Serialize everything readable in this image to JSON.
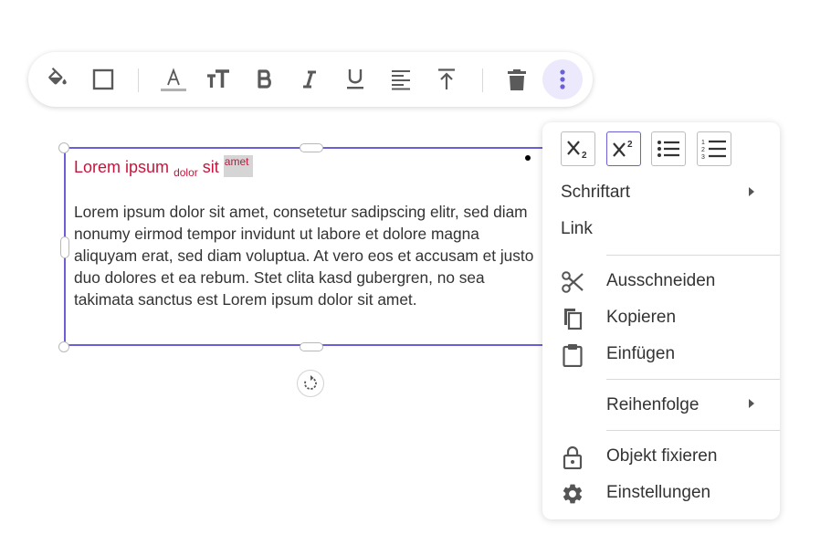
{
  "toolbar": {
    "buttons": [
      {
        "name": "fill-color",
        "icon": "paint-bucket-icon"
      },
      {
        "name": "border",
        "icon": "square-outline-icon"
      },
      {
        "name": "font-color",
        "icon": "font-color-icon",
        "glyph": "A"
      },
      {
        "name": "font-size",
        "icon": "font-size-icon",
        "glyph": "тT"
      },
      {
        "name": "bold",
        "icon": "bold-icon",
        "glyph": "B"
      },
      {
        "name": "italic",
        "icon": "italic-icon",
        "glyph": "I"
      },
      {
        "name": "underline",
        "icon": "underline-icon",
        "glyph": "U"
      },
      {
        "name": "align",
        "icon": "align-left-icon"
      },
      {
        "name": "vertical-align",
        "icon": "align-top-icon"
      },
      {
        "name": "delete",
        "icon": "trash-icon"
      },
      {
        "name": "more",
        "icon": "more-vertical-icon",
        "active": true
      }
    ]
  },
  "textbox": {
    "heading_main": "Lorem ipsum",
    "heading_sub": "dolor",
    "heading_after": "sit",
    "heading_sup": "amet",
    "body": "Lorem ipsum dolor sit amet, consetetur sadipscing elitr, sed diam nonumy eirmod tempor invidunt ut labore et dolore magna aliquyam erat, sed diam voluptua. At vero eos et accusam et justo duo dolores et ea rebum. Stet clita kasd gubergren, no sea takimata sanctus est Lorem ipsum dolor sit amet."
  },
  "context_menu": {
    "format_buttons": [
      {
        "name": "subscript",
        "icon": "subscript-icon",
        "active": false
      },
      {
        "name": "superscript",
        "icon": "superscript-icon",
        "active": true
      },
      {
        "name": "bullet-list",
        "icon": "bullet-list-icon",
        "active": false
      },
      {
        "name": "numbered-list",
        "icon": "numbered-list-icon",
        "active": false
      }
    ],
    "font": "Schriftart",
    "link": "Link",
    "cut": "Ausschneiden",
    "copy": "Kopieren",
    "paste": "Einfügen",
    "order": "Reihenfolge",
    "lock": "Objekt fixieren",
    "settings": "Einstellungen"
  },
  "colors": {
    "accent": "#6a5fd6",
    "heading": "#c8143c",
    "icon": "#5a5a5a"
  }
}
